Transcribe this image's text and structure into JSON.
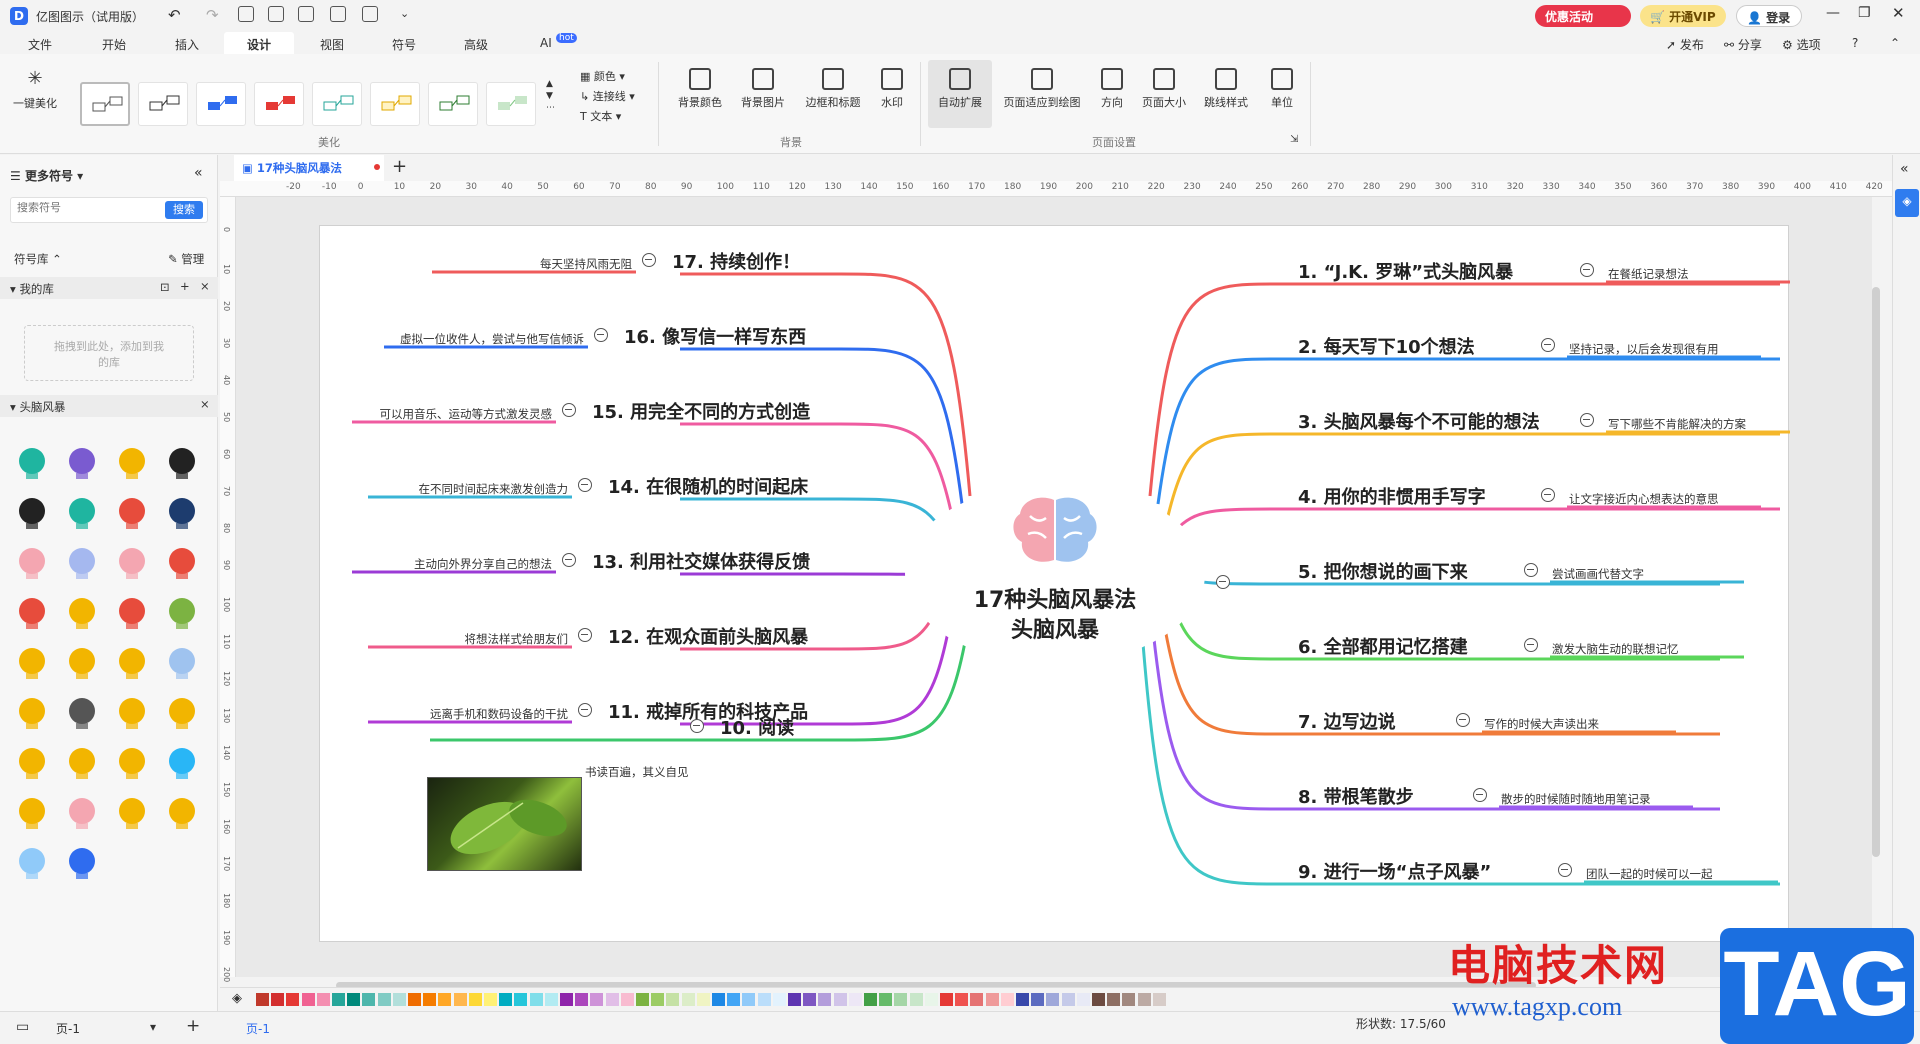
{
  "app": {
    "title": "亿图图示（试用版）",
    "promo": "优惠活动",
    "vip": "开通VIP",
    "login": "登录"
  },
  "menu": [
    "文件",
    "开始",
    "插入",
    "设计",
    "视图",
    "符号",
    "高级",
    "AI"
  ],
  "menu_badge": "hot",
  "menu_right": {
    "publish": "发布",
    "share": "分享",
    "options": "选项"
  },
  "ribbon": {
    "one_key": "一键美化",
    "beautify_group": "美化",
    "color": "颜色",
    "connector": "连接线",
    "text": "文本",
    "bg_color": "背景颜色",
    "bg_image": "背景图片",
    "border_title": "边框和标题",
    "watermark": "水印",
    "bg_group": "背景",
    "auto_expand": "自动扩展",
    "fit_page": "页面适应到绘图",
    "direction": "方向",
    "page_size": "页面大小",
    "jump_style": "跳线样式",
    "unit": "单位",
    "page_group": "页面设置"
  },
  "sidebar": {
    "more_symbols": "更多符号",
    "search_placeholder": "搜索符号",
    "search_btn": "搜索",
    "library": "符号库",
    "manage": "管理",
    "my_library": "我的库",
    "drop_hint": "拖拽到此处，添加到我的库",
    "brainstorm": "头脑风暴"
  },
  "doc": {
    "tab": "17种头脑风暴法"
  },
  "ruler": {
    "h": [
      "-20",
      "-10",
      "0",
      "10",
      "20",
      "30",
      "40",
      "50",
      "60",
      "70",
      "80",
      "90",
      "100",
      "110",
      "120",
      "130",
      "140",
      "150",
      "160",
      "170",
      "180",
      "190",
      "200",
      "210",
      "220",
      "230",
      "240",
      "250",
      "260",
      "270",
      "280",
      "290",
      "300",
      "310",
      "320",
      "330",
      "340",
      "350",
      "360",
      "370",
      "380",
      "390",
      "400",
      "410",
      "420",
      "430"
    ],
    "v": [
      "0",
      "10",
      "20",
      "30",
      "40",
      "50",
      "60",
      "70",
      "80",
      "90",
      "100",
      "110",
      "120",
      "130",
      "140",
      "150",
      "160",
      "170",
      "180",
      "190",
      "200"
    ]
  },
  "mindmap": {
    "center_line1": "17种头脑风暴法",
    "center_line2": "头脑风暴",
    "right": [
      {
        "title": "1.  “J.K. 罗琳”式头脑风暴",
        "sub": "在餐纸记录想法",
        "color": "#ef5b5b"
      },
      {
        "title": "2.  每天写下10个想法",
        "sub": "坚持记录，以后会发现很有用",
        "color": "#2f8cef"
      },
      {
        "title": "3.  头脑风暴每个不可能的想法",
        "sub": "写下哪些不肯能解决的方案",
        "color": "#f5b72a"
      },
      {
        "title": "4.  用你的非惯用手写字",
        "sub": "让文字接近内心想表达的意思",
        "color": "#ef5ba0"
      },
      {
        "title": "5.  把你想说的画下来",
        "sub": "尝试画画代替文字",
        "color": "#39b4d6"
      },
      {
        "title": "6.  全部都用记忆搭建",
        "sub": "激发大脑生动的联想记忆",
        "color": "#5bd65b"
      },
      {
        "title": "7.  边写边说",
        "sub": "写作的时候大声读出来",
        "color": "#f07b3a"
      },
      {
        "title": "8.  带根笔散步",
        "sub": "散步的时候随时随地用笔记录",
        "color": "#9b5bef"
      },
      {
        "title": "9.  进行一场“点子风暴”",
        "sub": "团队一起的时候可以一起",
        "color": "#3fc7c7"
      }
    ],
    "left": [
      {
        "title": "17.  持续创作！",
        "sub": "每天坚持风雨无阻",
        "color": "#ef5b5b"
      },
      {
        "title": "16.  像写信一样写东西",
        "sub": "虚拟一位收件人，尝试与他写信倾诉",
        "color": "#2f6cef"
      },
      {
        "title": "15.  用完全不同的方式创造",
        "sub": "可以用音乐、运动等方式激发灵感",
        "color": "#ef5ba0"
      },
      {
        "title": "14.  在很随机的时间起床",
        "sub": "在不同时间起床来激发创造力",
        "color": "#39b4d6"
      },
      {
        "title": "13.  利用社交媒体获得反馈",
        "sub": "主动向外界分享自己的想法",
        "color": "#9b3bd6"
      },
      {
        "title": "12.  在观众面前头脑风暴",
        "sub": "将想法样式给朋友们",
        "color": "#ef5b8b"
      },
      {
        "title": "11.  戒掉所有的科技产品",
        "sub": "远离手机和数码设备的干扰",
        "color": "#b03bd6"
      },
      {
        "title": "10.  阅读",
        "sub": "书读百遍，其义自见",
        "color": "#3bc76b"
      }
    ]
  },
  "status": {
    "page": "页-1",
    "page_tab": "页-1",
    "shapes": "形状数:  17.5/60"
  },
  "watermark": {
    "text": "电脑技术网",
    "url": "www.tagxp.com",
    "tag": "TAG"
  },
  "colors": [
    "#c0392b",
    "#d32f2f",
    "#e53935",
    "#f06292",
    "#f48fb1",
    "#26a69a",
    "#00897b",
    "#4db6ac",
    "#80cbc4",
    "#b2dfdb",
    "#ef6c00",
    "#f57c00",
    "#ffa726",
    "#ffb74d",
    "#fdd835",
    "#fff176",
    "#00acc1",
    "#26c6da",
    "#80deea",
    "#b2ebf2",
    "#8e24aa",
    "#ab47bc",
    "#ce93d8",
    "#e1bee7",
    "#f8bbd0",
    "#7cb342",
    "#9ccc65",
    "#c5e1a5",
    "#dcedc8",
    "#f0f4c3",
    "#1e88e5",
    "#42a5f5",
    "#90caf9",
    "#bbdefb",
    "#e3f2fd",
    "#5e35b1",
    "#7e57c2",
    "#b39ddb",
    "#d1c4e9",
    "#ede7f6",
    "#43a047",
    "#66bb6a",
    "#a5d6a7",
    "#c8e6c9",
    "#e8f5e9",
    "#e53935",
    "#ef5350",
    "#e57373",
    "#ef9a9a",
    "#ffcdd2",
    "#3949ab",
    "#5c6bc0",
    "#9fa8da",
    "#c5cae9",
    "#e8eaf6",
    "#6d4c41",
    "#8d6e63",
    "#a1887f",
    "#bcaaa4",
    "#d7ccc8"
  ]
}
